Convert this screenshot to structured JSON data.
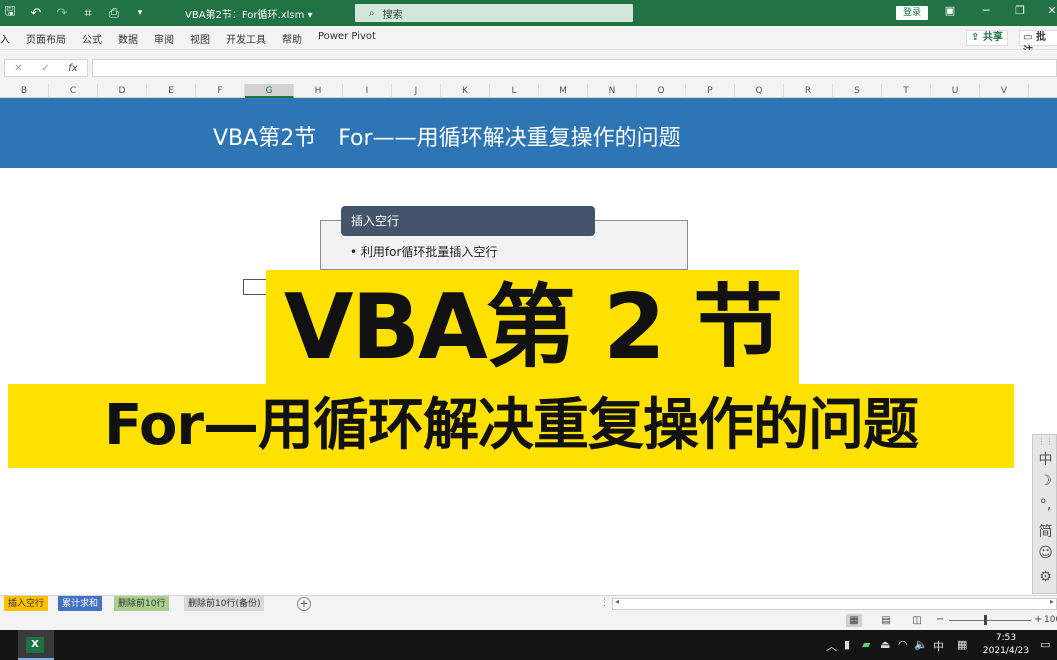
{
  "window": {
    "title": "VBA第2节：For循环.xlsm",
    "title_caret": "▾",
    "search_placeholder": "搜索",
    "login_label": "登录"
  },
  "ribbon": {
    "tabs": [
      "入",
      "页面布局",
      "公式",
      "数据",
      "审阅",
      "视图",
      "开发工具",
      "帮助",
      "Power Pivot"
    ],
    "share_label": "共享",
    "comment_label": "批注"
  },
  "formula_bar": {
    "cancel": "✕",
    "enter": "✓",
    "fx": "fx",
    "value": ""
  },
  "columns": [
    "B",
    "C",
    "D",
    "E",
    "F",
    "G",
    "H",
    "I",
    "J",
    "K",
    "L",
    "M",
    "N",
    "O",
    "P",
    "Q",
    "R",
    "S",
    "T",
    "U",
    "V"
  ],
  "selected_column": "G",
  "sheet": {
    "banner_title": "VBA第2节　For——用循环解决重复操作的问题",
    "smartart_heading": "插入空行",
    "smartart_bullet": "• 利用for循环批量插入空行",
    "overlay_line1": "VBA第 2 节",
    "overlay_line2": "For—用循环解决重复操作的问题"
  },
  "ime": [
    "中",
    "☽",
    "°,",
    "简",
    "☺",
    "⚙"
  ],
  "sheet_tabs": [
    {
      "label": "插入空行",
      "color": "#ffc000"
    },
    {
      "label": "累计求和",
      "color": "#4472c4"
    },
    {
      "label": "删除前10行",
      "color": "#a9d08e"
    },
    {
      "label": "删除前10行(备份)",
      "color": "#d9d9d9"
    }
  ],
  "statusbar": {
    "zoom": "100"
  },
  "taskbar": {
    "excel_label": "X",
    "ime_mode": "中",
    "time": "7:53",
    "date": "2021/4/23"
  }
}
